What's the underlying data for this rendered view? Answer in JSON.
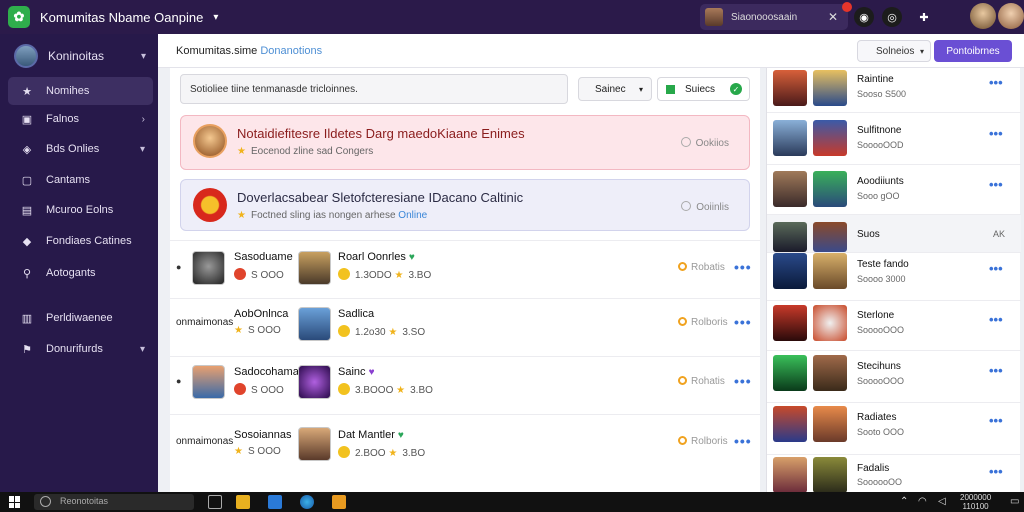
{
  "app": {
    "title": "Komumitas Nbame Oanpine",
    "logo": "app-logo-icon"
  },
  "titlebar": {
    "user_name": "Siaonooosaain"
  },
  "sidebar": {
    "user_name": "Koninoitas",
    "items": [
      {
        "label": "Nomihes",
        "icon": "star-icon",
        "active": true
      },
      {
        "label": "Falnos",
        "icon": "bag-icon",
        "chevron": true
      },
      {
        "label": "Bds Onlies",
        "icon": "gamepad-icon",
        "chevron": true
      },
      {
        "label": "Cantams",
        "icon": "chat-icon"
      },
      {
        "label": "Mcuroo Eolns",
        "icon": "calendar-icon"
      },
      {
        "label": "Fondiaes Catines",
        "icon": "shield-icon"
      },
      {
        "label": "Aotogants",
        "icon": "search-icon"
      },
      {
        "label": "Perldiwaenee",
        "icon": "list-icon"
      },
      {
        "label": "Donurifurds",
        "icon": "flag-icon",
        "chevron": true
      }
    ]
  },
  "header": {
    "breadcrumb_main": "Komumitas.sime",
    "breadcrumb_accent": "Donanotions",
    "select_label": "Solneios",
    "button_label": "Pontoibrnes"
  },
  "main": {
    "search_text": "Sotioliee tiine tenmanasde tricloinnes.",
    "filter_label": "Sainec",
    "status_label": "Suiecs"
  },
  "banners": [
    {
      "title": "Notaidiefitesre Ildetes Darg maedoKiaane Enimes",
      "sub": "Eocenod zline sad Congers",
      "action": "Ookiios",
      "online": ""
    },
    {
      "title": "Doverlacsabear Sletofcteresiane IDacano Caltinic",
      "sub": "Foctned sling ias nongen arhese",
      "action": "Ooiinlis",
      "online": "Online"
    }
  ],
  "rows": [
    {
      "prefix": "",
      "left_name": "Sasoduame",
      "left_meta": "S OOO",
      "right_name": "Roarl Oonrles",
      "right_meta": "1.3ODO",
      "right_meta2": "3.BO",
      "heart": "green",
      "action": "Robatis"
    },
    {
      "prefix": "onmaimonas",
      "left_name": "AobOnlnca",
      "left_meta": "S OOO",
      "right_name": "Sadlica",
      "right_meta": "1.2o30",
      "right_meta2": "3.SO",
      "heart": "",
      "action": "Rolboris"
    },
    {
      "prefix": "",
      "left_name": "Sadocohama",
      "left_meta": "S OOO",
      "right_name": "Sainc",
      "right_meta": "3.BOOO",
      "right_meta2": "3.BO",
      "heart": "purple",
      "action": "Rohatis"
    },
    {
      "prefix": "onmaimonas",
      "left_name": "Sosoiannas",
      "left_meta": "S OOO",
      "right_name": "Dat Mantler",
      "right_meta": "2.BOO",
      "right_meta2": "3.BO",
      "heart": "green",
      "action": "Rolboris"
    }
  ],
  "right_panel": [
    {
      "name": "Raintine",
      "meta": "Sooso S500",
      "colors": [
        "#a33a2a",
        "#3b5a8a"
      ]
    },
    {
      "name": "Sulfitnone",
      "meta": "SooooOOD",
      "colors": [
        "#3a5a7a",
        "#8a3a2a"
      ]
    },
    {
      "name": "Aoodiiunts",
      "meta": "Sooo gOO",
      "colors": [
        "#5a4a3a",
        "#2a7a5a"
      ]
    },
    {
      "name": "Suos",
      "meta": "AK",
      "colors": [
        "#2a3a4a",
        "#3a5a8a"
      ]
    },
    {
      "name": "Teste fando",
      "meta": "Soooo 3000",
      "colors": [
        "#3a4a6a",
        "#c8a05a"
      ]
    },
    {
      "name": "Sterlone",
      "meta": "SooooOOO",
      "colors": [
        "#8a2a2a",
        "#d8d8d8"
      ]
    },
    {
      "name": "Stecihuns",
      "meta": "SooooOOO",
      "colors": [
        "#2a7a3a",
        "#6a4a3a"
      ]
    },
    {
      "name": "Radiates",
      "meta": "Sooto OOO",
      "colors": [
        "#8a3a2a",
        "#a06a3a"
      ]
    },
    {
      "name": "Fadalis",
      "meta": "SoooooOO",
      "colors": [
        "#8a5a2a",
        "#4a4a2a"
      ]
    }
  ],
  "taskbar": {
    "search_text": "Reonotoitas",
    "time": "2000000",
    "date": "110100"
  },
  "colors": {
    "sidebar": "#27194a",
    "accent": "#6a4fd4",
    "titlebar": "#2b1a4a"
  }
}
